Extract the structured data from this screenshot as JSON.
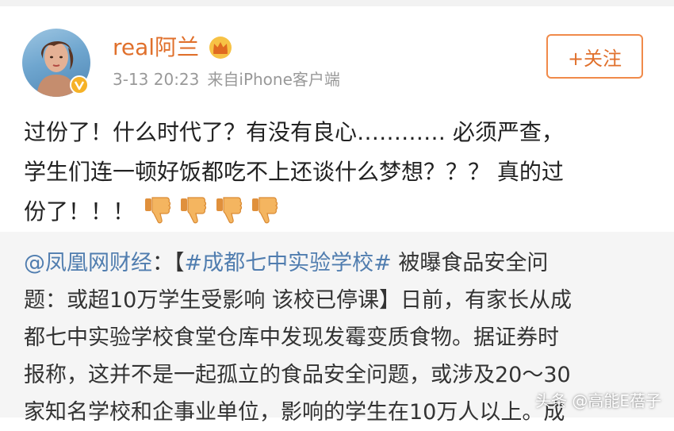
{
  "post": {
    "username": "real阿兰",
    "timestamp": "3-13 20:23",
    "source": "来自iPhone客户端",
    "follow_label": "+关注",
    "text_lines": [
      "过份了！什么时代了？有没有良心………… 必须严查，",
      "学生们连一顿好饭都吃不上还谈什么梦想？？？ 真的过",
      "份了！！！"
    ],
    "thumb_icon": "thumbs-down-icon",
    "thumb_count": 4
  },
  "repost": {
    "author": "@凤凰网财经",
    "line1_sep": "：【",
    "hashtag": "#成都七中实验学校#",
    "line1_rest": " 被曝食品安全问",
    "lines": [
      "题：或超10万学生受影响 该校已停课】日前，有家长从成",
      "都七中实验学校食堂仓库中发现发霉变质食物。据证券时",
      "报称，这并不是一起孤立的食品安全问题，或涉及20～30",
      "家知名学校和企事业单位，影响的学生在10万人以上。成"
    ]
  },
  "watermark": "头条 @高能E蓓子",
  "colors": {
    "username": "#e0702c",
    "link": "#507daf",
    "meta": "#999999",
    "repost_bg": "#f5f5f5"
  }
}
